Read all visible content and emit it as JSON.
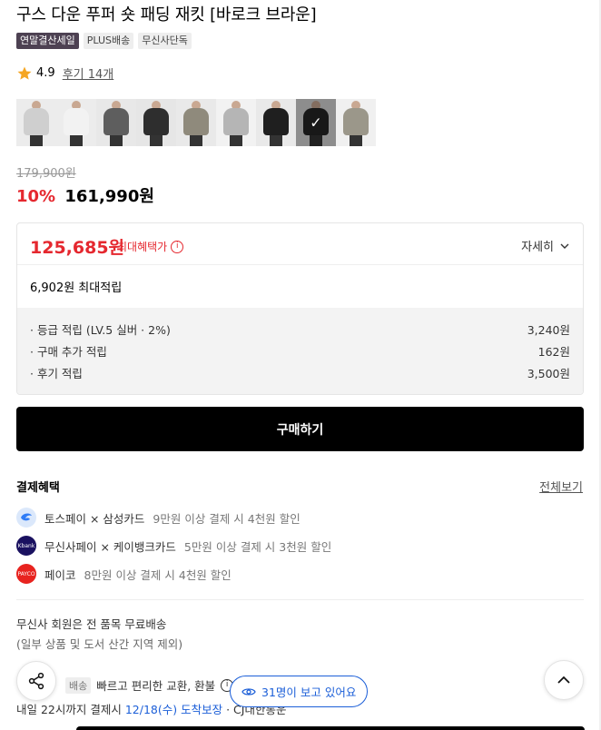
{
  "product": {
    "title": "구스 다운 푸퍼 숏 패딩 재킷 [바로크 브라운]",
    "badges": [
      "연말결산세일",
      "PLUS배송",
      "무신사단독"
    ],
    "rating": "4.9",
    "review_link": "후기 14개",
    "thumbnails": [
      {
        "icon": "thumb-light-gray",
        "color": "#cfcfcf"
      },
      {
        "icon": "thumb-white",
        "color": "#f2f2f2"
      },
      {
        "icon": "thumb-charcoal",
        "color": "#5e5e5e"
      },
      {
        "icon": "thumb-black",
        "color": "#2e2e2e"
      },
      {
        "icon": "thumb-khaki",
        "color": "#8f8a7c"
      },
      {
        "icon": "thumb-gray-model",
        "color": "#b5b5b5"
      },
      {
        "icon": "thumb-black-2",
        "color": "#1f1f1f"
      },
      {
        "icon": "thumb-selected-black",
        "color": "#252525"
      },
      {
        "icon": "thumb-beige",
        "color": "#9b978a"
      }
    ],
    "selected_check": "✓",
    "original_price": "179,900원",
    "discount_percent": "10%",
    "sale_price": "161,990원"
  },
  "benefit": {
    "max_price": "125,685원",
    "max_price_label": "최대혜택가",
    "info_glyph": "i",
    "detail_label": "자세히",
    "max_points": "6,902원 최대적립",
    "rows": [
      {
        "label": "· 등급 적립 (LV.5 실버 · 2%)",
        "value": "3,240원"
      },
      {
        "label": "· 구매 추가 적립",
        "value": "162원"
      },
      {
        "label": "· 후기 적립",
        "value": "3,500원"
      }
    ]
  },
  "buy_button": "구매하기",
  "payment": {
    "title": "결제혜택",
    "view_all": "전체보기",
    "rows": [
      {
        "logo": "toss-logo",
        "logo_text": "",
        "main": "토스페이 × 삼성카드",
        "detail": "9만원 이상 결제 시 4천원 할인"
      },
      {
        "logo": "kbank-logo",
        "logo_text": "Kbank",
        "main": "무신사페이 × 케이뱅크카드",
        "detail": "5만원 이상 결제 시 3천원 할인"
      },
      {
        "logo": "payco-logo",
        "logo_text": "PAYCO",
        "main": "페이코",
        "detail": "8만원 이상 결제 시 4천원 할인"
      }
    ]
  },
  "shipping": {
    "line1": "무신사 회원은 전 품목 무료배송",
    "line2": "(일부 상품 및 도서 산간 지역 제외)",
    "exchange_badge": "배송",
    "exchange_text": "빠르고 편리한 교환, 환불",
    "arrive_prefix": "내일 22시까지 결제시",
    "arrive_date": "12/18(수) 도착보장",
    "arrive_suffix": "· CJ대한통운"
  },
  "floating": {
    "viewers": "31명이 보고 있어요"
  },
  "colors": {
    "accent_red": "#e5282f",
    "accent_blue": "#1c5fd8"
  }
}
